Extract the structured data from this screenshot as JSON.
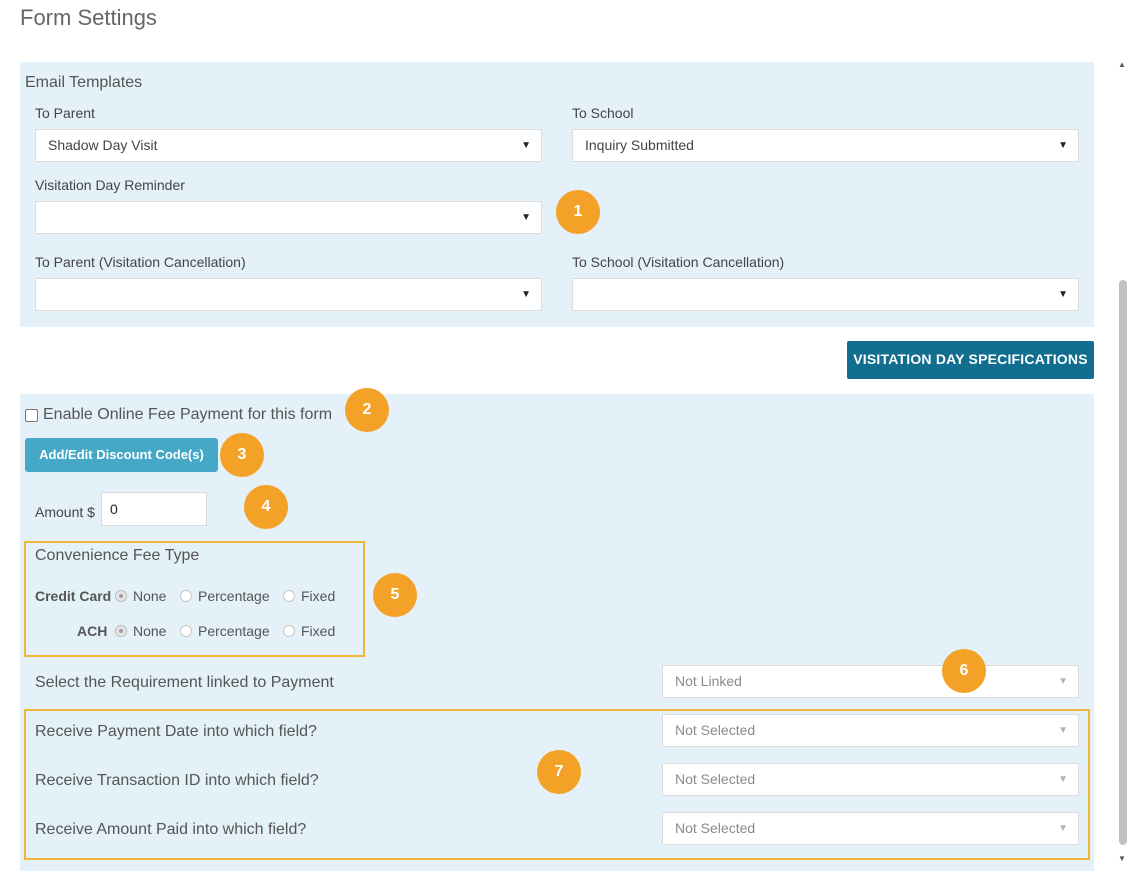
{
  "page_title": "Form Settings",
  "email_templates": {
    "title": "Email Templates",
    "to_parent": {
      "label": "To Parent",
      "value": "Shadow Day Visit"
    },
    "to_school": {
      "label": "To School",
      "value": "Inquiry Submitted"
    },
    "visitation_reminder": {
      "label": "Visitation Day Reminder",
      "value": ""
    },
    "to_parent_cancel": {
      "label": "To Parent (Visitation Cancellation)",
      "value": ""
    },
    "to_school_cancel": {
      "label": "To School (Visitation Cancellation)",
      "value": ""
    }
  },
  "visitation_button": "VISITATION DAY SPECIFICATIONS",
  "payment": {
    "enable_label": "Enable Online Fee Payment for this form",
    "enable_checked": false,
    "discount_button": "Add/Edit Discount Code(s)",
    "amount_label": "Amount $",
    "amount_value": "0",
    "convenience": {
      "title": "Convenience Fee Type",
      "rows": [
        {
          "label": "Credit Card",
          "selected": "None"
        },
        {
          "label": "ACH",
          "selected": "None"
        }
      ],
      "options": [
        "None",
        "Percentage",
        "Fixed"
      ]
    },
    "requirement": {
      "label": "Select the Requirement linked to Payment",
      "value": "Not Linked"
    },
    "payment_date": {
      "label": "Receive Payment Date into which field?",
      "value": "Not Selected"
    },
    "transaction_id": {
      "label": "Receive Transaction ID into which field?",
      "value": "Not Selected"
    },
    "amount_paid": {
      "label": "Receive Amount Paid into which field?",
      "value": "Not Selected"
    }
  },
  "badges": [
    "1",
    "2",
    "3",
    "4",
    "5",
    "6",
    "7"
  ],
  "icons": {
    "caret": "caret-down-icon",
    "scroll_up": "triangle-up-icon",
    "scroll_down": "triangle-down-icon"
  },
  "colors": {
    "panel": "#e4f1f8",
    "primary": "#116e8f",
    "info": "#44a8c6",
    "badge": "#f4a127",
    "outline": "#f0b63a"
  }
}
